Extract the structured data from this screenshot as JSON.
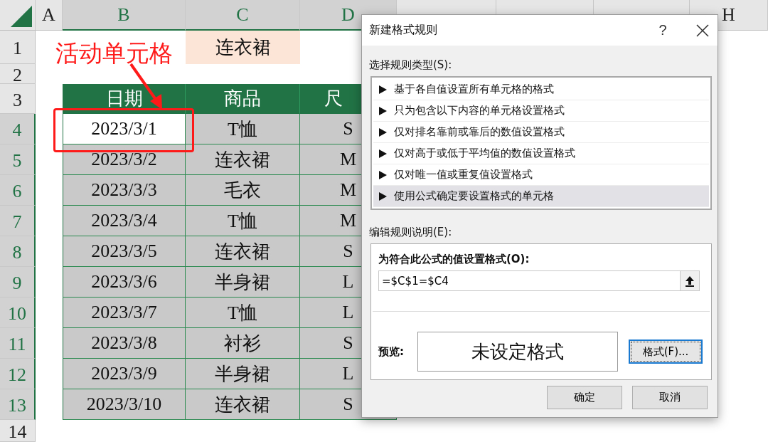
{
  "sheet": {
    "columns": [
      {
        "label": "A",
        "selected": false
      },
      {
        "label": "B",
        "selected": true
      },
      {
        "label": "C",
        "selected": true
      },
      {
        "label": "D",
        "selected": true
      },
      {
        "label": "H",
        "selected": false
      }
    ],
    "rows": [
      {
        "label": "1",
        "selected": false,
        "kind": "plain",
        "cells": [
          {},
          {
            "text": "连衣裙",
            "filled": true
          },
          {}
        ]
      },
      {
        "label": "2",
        "selected": false,
        "kind": "plain"
      },
      {
        "label": "3",
        "selected": false,
        "kind": "table-head",
        "cells": [
          {
            "text": "日期"
          },
          {
            "text": "商品"
          },
          {
            "text": "尺"
          }
        ]
      },
      {
        "label": "4",
        "selected": true,
        "kind": "table-body",
        "cells": [
          {
            "text": "2023/3/1",
            "active": true
          },
          {
            "text": "T恤",
            "active": false
          },
          {
            "text": "S",
            "active": false
          }
        ]
      },
      {
        "label": "5",
        "selected": true,
        "kind": "table-body",
        "cells": [
          {
            "text": "2023/3/2",
            "active": false
          },
          {
            "text": "连衣裙",
            "active": false
          },
          {
            "text": "M",
            "active": false
          }
        ]
      },
      {
        "label": "6",
        "selected": true,
        "kind": "table-body",
        "cells": [
          {
            "text": "2023/3/3",
            "active": false
          },
          {
            "text": "毛衣",
            "active": false
          },
          {
            "text": "M",
            "active": false
          }
        ]
      },
      {
        "label": "7",
        "selected": true,
        "kind": "table-body",
        "cells": [
          {
            "text": "2023/3/4",
            "active": false
          },
          {
            "text": "T恤",
            "active": false
          },
          {
            "text": "M",
            "active": false
          }
        ]
      },
      {
        "label": "8",
        "selected": true,
        "kind": "table-body",
        "cells": [
          {
            "text": "2023/3/5",
            "active": false
          },
          {
            "text": "连衣裙",
            "active": false
          },
          {
            "text": "S",
            "active": false
          }
        ]
      },
      {
        "label": "9",
        "selected": true,
        "kind": "table-body",
        "cells": [
          {
            "text": "2023/3/6",
            "active": false
          },
          {
            "text": "半身裙",
            "active": false
          },
          {
            "text": "L",
            "active": false
          }
        ]
      },
      {
        "label": "10",
        "selected": true,
        "kind": "table-body",
        "cells": [
          {
            "text": "2023/3/7",
            "active": false
          },
          {
            "text": "T恤",
            "active": false
          },
          {
            "text": "L",
            "active": false
          }
        ]
      },
      {
        "label": "11",
        "selected": true,
        "kind": "table-body",
        "cells": [
          {
            "text": "2023/3/8",
            "active": false
          },
          {
            "text": "衬衫",
            "active": false
          },
          {
            "text": "S",
            "active": false
          }
        ]
      },
      {
        "label": "12",
        "selected": true,
        "kind": "table-body",
        "cells": [
          {
            "text": "2023/3/9",
            "active": false
          },
          {
            "text": "半身裙",
            "active": false
          },
          {
            "text": "L",
            "active": false
          }
        ]
      },
      {
        "label": "13",
        "selected": true,
        "kind": "table-body",
        "cells": [
          {
            "text": "2023/3/10",
            "active": false
          },
          {
            "text": "连衣裙",
            "active": false
          },
          {
            "text": "S",
            "active": false
          }
        ]
      },
      {
        "label": "14",
        "selected": false,
        "kind": "plain"
      }
    ],
    "annotation": {
      "text": "活动单元格"
    }
  },
  "dialog": {
    "title": "新建格式规则",
    "help": "?",
    "rule_type_label": "选择规则类型(S):",
    "rule_types": [
      {
        "label": "基于各自值设置所有单元格的格式",
        "selected": false
      },
      {
        "label": "只为包含以下内容的单元格设置格式",
        "selected": false
      },
      {
        "label": "仅对排名靠前或靠后的数值设置格式",
        "selected": false
      },
      {
        "label": "仅对高于或低于平均值的数值设置格式",
        "selected": false
      },
      {
        "label": "仅对唯一值或重复值设置格式",
        "selected": false
      },
      {
        "label": "使用公式确定要设置格式的单元格",
        "selected": true
      }
    ],
    "description_label": "编辑规则说明(E):",
    "formula_label": "为符合此公式的值设置格式(O):",
    "formula": "=$C$1=$C4",
    "preview_label": "预览:",
    "preview_text": "未设定格式",
    "format_button": "格式(F)...",
    "buttons": [
      "确定",
      "取消"
    ]
  }
}
